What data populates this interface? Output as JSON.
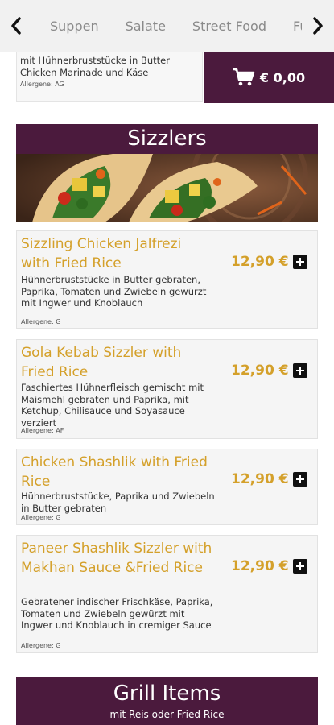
{
  "nav": {
    "categories": [
      "Suppen",
      "Salate",
      "Street Food",
      "Fu"
    ]
  },
  "previous_item": {
    "description": "mit Hühnerbruststücke in Butter Chicken Marinade und Käse",
    "allergene": "Allergene: AG"
  },
  "cart": {
    "total": "€ 0,00"
  },
  "sizzlers": {
    "title": "Sizzlers",
    "items": [
      {
        "name": "Sizzling Chicken Jalfrezi with Fried Rice",
        "description": "Hühnerbruststücke in Butter gebraten, Paprika, Tomaten und Zwiebeln gewürzt mit Ingwer und Knoblauch",
        "allergene": "Allergene: G",
        "price": "12,90 €"
      },
      {
        "name": "Gola Kebab Sizzler with Fried Rice",
        "description": "Faschiertes Hühnerfleisch gemischt mit Maismehl gebraten und Paprika, mit Ketchup, Chilisauce und Soyasauce verziert",
        "allergene": "Allergene: AF",
        "price": "12,90 €"
      },
      {
        "name": "Chicken Shashlik with Fried Rice",
        "description": "Hühnerbruststücke, Paprika und Zwiebeln in Butter gebraten",
        "allergene": "Allergene: G",
        "price": "12,90 €"
      },
      {
        "name": "Paneer Shashlik Sizzler with Makhan Sauce &Fried Rice",
        "description": "Gebratener indischer Frischkäse, Paprika, Tomaten und Zwiebeln gewürzt mit Ingwer und Knoblauch in cremiger Sauce",
        "allergene": "Allergene: G",
        "price": "12,90 €"
      }
    ]
  },
  "grill": {
    "title": "Grill Items",
    "subtitle": "mit Reis oder Fried Rice"
  },
  "colors": {
    "brand_purple": "#4b1a3d",
    "accent_gold": "#d4a02a"
  }
}
